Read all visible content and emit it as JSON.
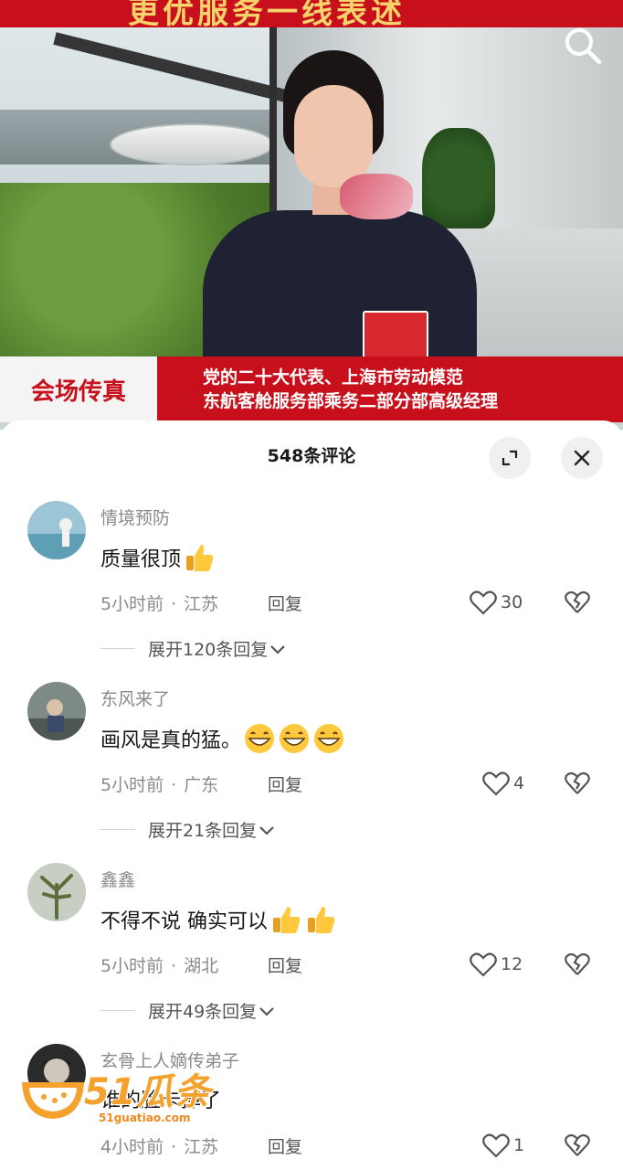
{
  "video": {
    "banner_text": "更优服务一线表述",
    "caption_tag": "会场传真",
    "caption_lines": [
      "党的二十大代表、上海市劳动模范",
      "东航客舱服务部乘务二部分部高级经理"
    ]
  },
  "sheet": {
    "title": "548条评论"
  },
  "comments": [
    {
      "username": "情境预防",
      "text": "质量很顶",
      "time": "5小时前",
      "location": "江苏",
      "reply_label": "回复",
      "likes": "30",
      "expand": "展开120条回复"
    },
    {
      "username": "东风来了",
      "text": "画风是真的猛。",
      "time": "5小时前",
      "location": "广东",
      "reply_label": "回复",
      "likes": "4",
      "expand": "展开21条回复"
    },
    {
      "username": "鑫鑫",
      "text": "不得不说 确实可以",
      "time": "5小时前",
      "location": "湖北",
      "reply_label": "回复",
      "likes": "12",
      "expand": "展开49条回复"
    },
    {
      "username": "玄骨上人嫡传弟子",
      "text": "谁的脸卡掉了",
      "time": "4小时前",
      "location": "江苏",
      "reply_label": "回复",
      "likes": "1"
    }
  ],
  "watermark": {
    "brand": "51瓜条",
    "url": "51guatiao.com"
  },
  "icons": {
    "search": "search-icon",
    "expand": "expand-icon",
    "close": "close-icon",
    "like": "heart-icon",
    "dislike": "broken-heart-icon",
    "chevron": "chevron-down-icon",
    "thumbs_up": "thumbs-up-emoji",
    "grin": "grinning-emoji"
  },
  "colors": {
    "brand_red": "#c8101c",
    "text_gray": "#8a8a8a",
    "watermark_orange": "#f4a12e"
  }
}
